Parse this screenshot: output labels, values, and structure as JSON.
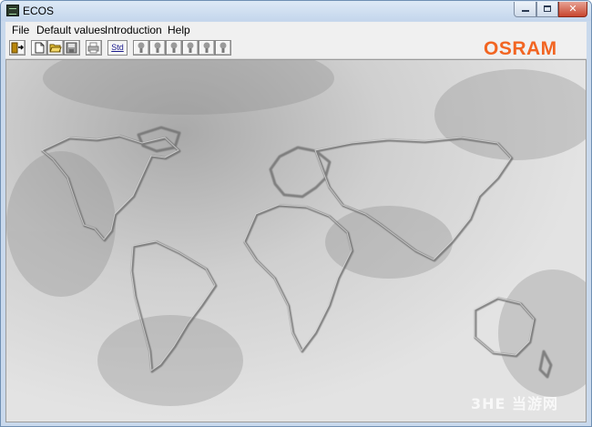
{
  "window": {
    "title": "ECOS",
    "icon": "ecos-app-icon",
    "controls": [
      "minimize",
      "maximize",
      "close"
    ]
  },
  "menu": {
    "items": [
      "File",
      "Default values",
      "Introduction",
      "Help"
    ]
  },
  "toolbar": {
    "buttons": [
      {
        "icon": "exit-door-icon"
      },
      {
        "icon": "new-document-icon"
      },
      {
        "icon": "open-folder-icon"
      },
      {
        "icon": "save-disk-icon"
      },
      {
        "icon": "print-icon"
      },
      {
        "icon": "std-icon",
        "label": "Std"
      },
      {
        "icon": "lamp-icon"
      },
      {
        "icon": "lamp-icon"
      },
      {
        "icon": "lamp-icon"
      },
      {
        "icon": "lamp-icon"
      },
      {
        "icon": "lamp-icon"
      },
      {
        "icon": "lamp-icon"
      }
    ],
    "logo": "OSRAM",
    "logo_color": "#f26522"
  },
  "main": {
    "background": "world-map-marble",
    "watermark": "3HE 当游网"
  }
}
